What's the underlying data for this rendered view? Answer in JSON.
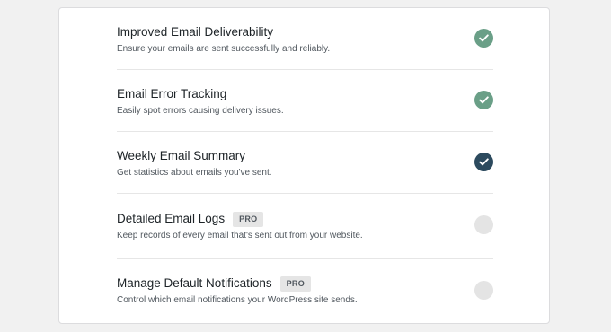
{
  "features": [
    {
      "title": "Improved Email Deliverability",
      "description": "Ensure your emails are sent successfully and reliably.",
      "badge": "",
      "status": "enabled",
      "status_color": "#6a9f87",
      "icon": "check-icon"
    },
    {
      "title": "Email Error Tracking",
      "description": "Easily spot errors causing delivery issues.",
      "badge": "",
      "status": "enabled",
      "status_color": "#6a9f87",
      "icon": "check-icon"
    },
    {
      "title": "Weekly Email Summary",
      "description": "Get statistics about emails you've sent.",
      "badge": "",
      "status": "enabled",
      "status_color": "#2c4a5e",
      "icon": "check-icon"
    },
    {
      "title": "Detailed Email Logs",
      "description": "Keep records of every email that's sent out from your website.",
      "badge": "PRO",
      "status": "disabled",
      "status_color": "#e4e4e4",
      "icon": "empty-circle-icon"
    },
    {
      "title": "Manage Default Notifications",
      "description": "Control which email notifications your WordPress site sends.",
      "badge": "PRO",
      "status": "disabled",
      "status_color": "#e4e4e4",
      "icon": "empty-circle-icon"
    }
  ]
}
